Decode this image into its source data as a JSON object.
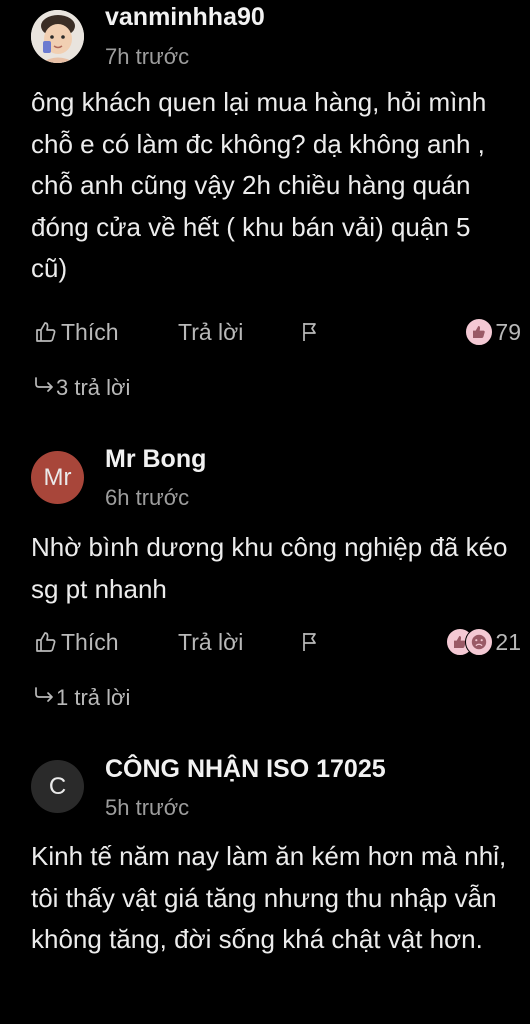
{
  "comments": [
    {
      "author": "vanminhha90",
      "time": "7h trước",
      "avatar_text": "",
      "avatar_color": "#e7e2dc",
      "text": "ông khách quen lại mua hàng, hỏi mình chỗ e có làm đc không? dạ không anh , chỗ anh cũng vậy 2h chiều hàng quán đóng cửa về hết ( khu bán vải) quận 5 cũ)",
      "like_label": "Thích",
      "reply_label": "Trả lời",
      "reaction_count": "79",
      "replies_label": "3 trả lời"
    },
    {
      "author": "Mr Bong",
      "time": "6h trước",
      "avatar_text": "Mr",
      "avatar_color": "#a8463a",
      "text": "Nhờ bình dương khu công nghiệp đã kéo sg pt nhanh",
      "like_label": "Thích",
      "reply_label": "Trả lời",
      "reaction_count": "21",
      "replies_label": "1 trả lời"
    },
    {
      "author": "CÔNG NHẬN ISO 17025",
      "time": "5h trước",
      "avatar_text": "C",
      "avatar_color": "#2a2a2a",
      "text": "Kinh tế năm nay làm ăn kém hơn mà nhỉ, tôi thấy vật giá tăng nhưng thu nhập vẫn không tăng, đời sống khá chật vật hơn."
    }
  ],
  "colors": {
    "background": "#000000",
    "text": "#ececec",
    "muted": "#9d9d9d",
    "reaction_bg": "#f4c9d4"
  }
}
